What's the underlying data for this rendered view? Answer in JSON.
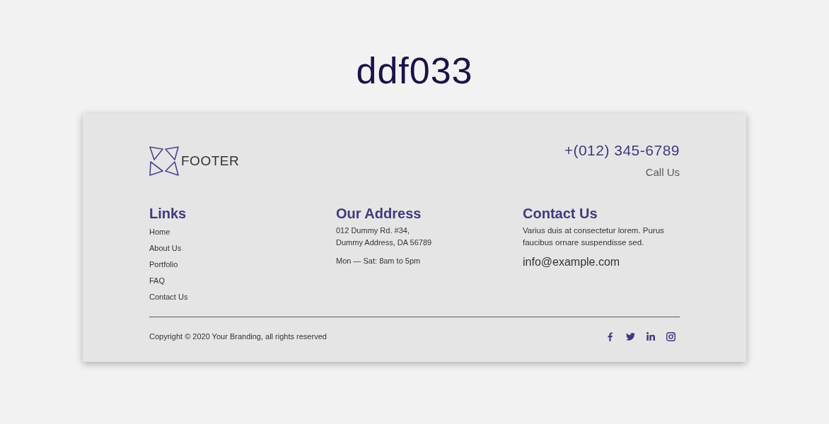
{
  "page_title": "ddf033",
  "footer": {
    "logo_text": "FOOTER",
    "phone": "+(012) 345-6789",
    "phone_caption": "Call Us",
    "columns": [
      {
        "kind": "links",
        "heading": "Links",
        "items": [
          "Home",
          "About Us",
          "Portfolio",
          "FAQ",
          "Contact Us"
        ]
      },
      {
        "kind": "address",
        "heading": "Our Address",
        "lines": [
          "012 Dummy Rd. #34,",
          "Dummy Address, DA 56789"
        ],
        "hours": "Mon — Sat: 8am to 5pm"
      },
      {
        "kind": "contact",
        "heading": "Contact Us",
        "text": "Varius duis at consectetur lorem. Purus faucibus ornare suspendisse sed.",
        "email": "info@example.com"
      }
    ],
    "copyright": "Copyright © 2020 Your Branding, all rights reserved"
  }
}
